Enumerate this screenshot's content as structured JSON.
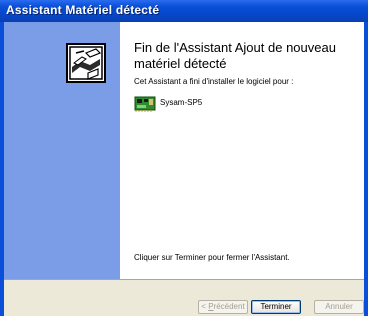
{
  "window": {
    "title": "Assistant Matériel détecté"
  },
  "wizard": {
    "heading": "Fin de l'Assistant Ajout de nouveau matériel détecté",
    "intro": "Cet Assistant a fini d'installer le logiciel pour :",
    "device_name": "Sysam-SP5",
    "closing": "Cliquer sur Terminer pour fermer l'Assistant."
  },
  "buttons": {
    "prev_prefix": "< ",
    "prev_accel": "P",
    "prev_rest": "récédent",
    "finish": "Terminer",
    "cancel": "Annuler"
  },
  "icons": {
    "wizard": "hardware-wizard-icon",
    "device": "circuit-board-icon"
  },
  "colors": {
    "title_bar": "#0a4fd8",
    "side_panel": "#7b9ce6",
    "footer": "#ece9d8"
  }
}
